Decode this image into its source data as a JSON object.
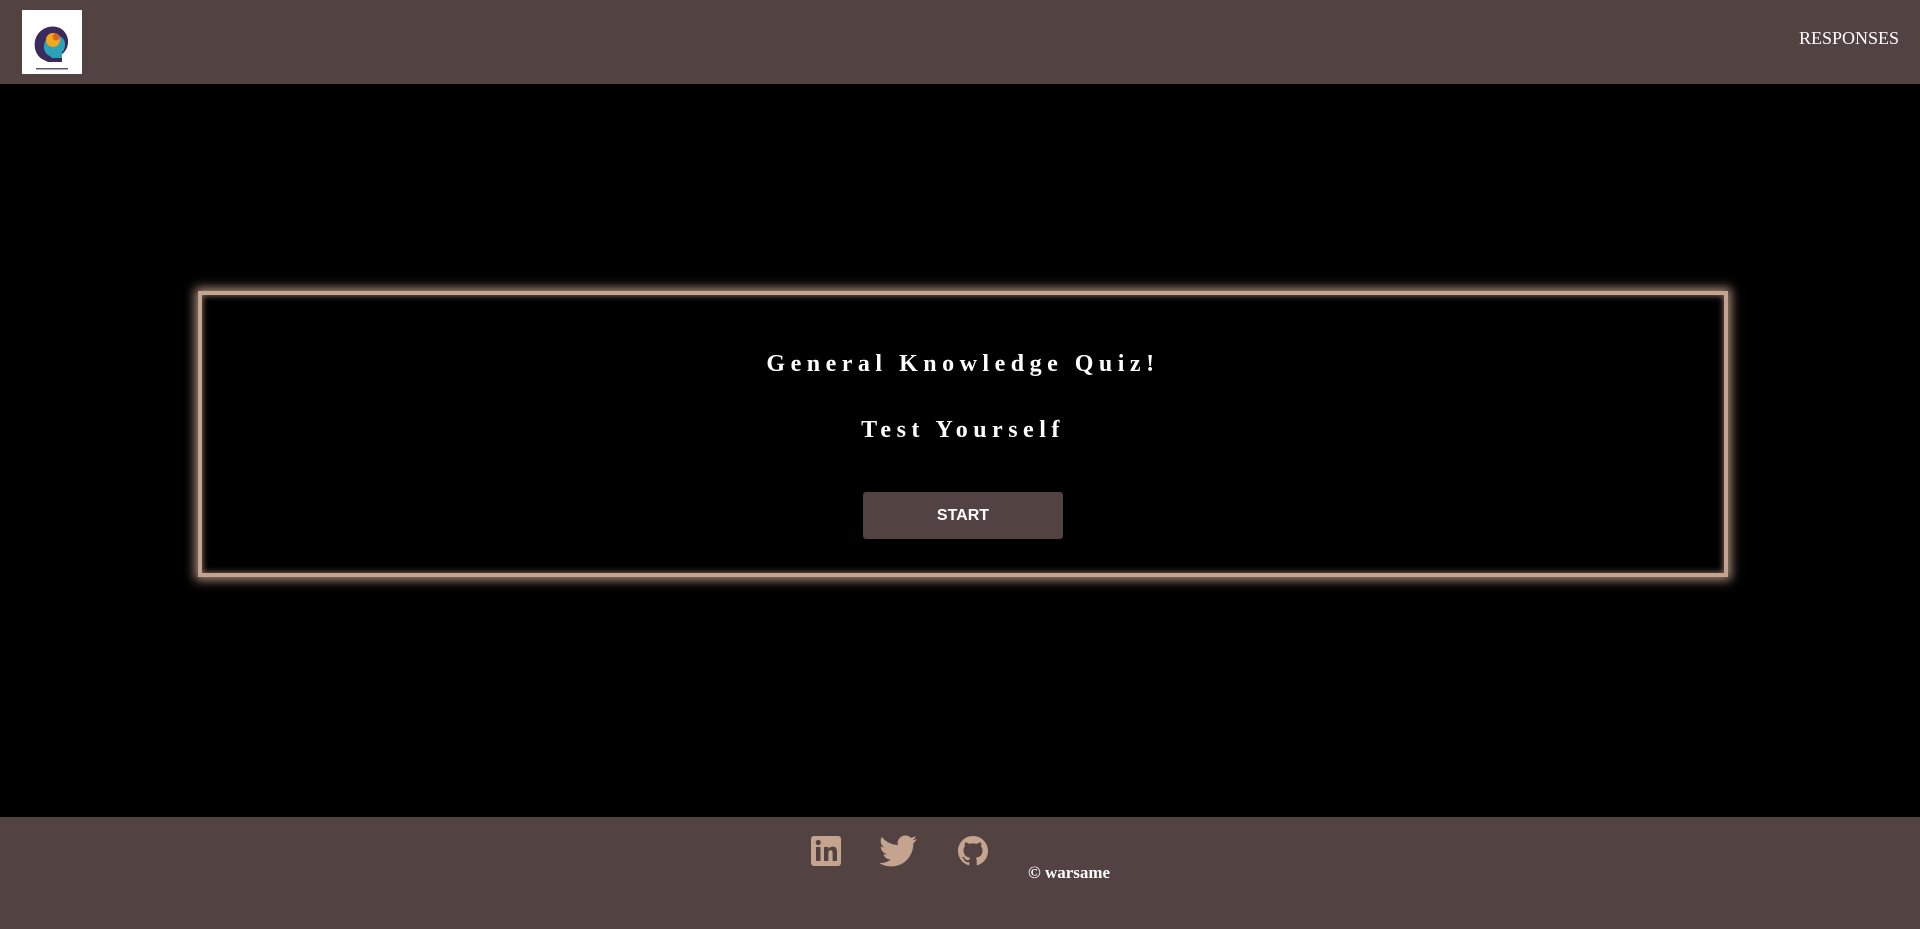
{
  "colors": {
    "nav_background": "#524241",
    "page_background": "#000000",
    "card_border": "#c4a48f",
    "button_background": "#524241",
    "icon_color": "#c4a48f",
    "text": "#ffffff"
  },
  "header": {
    "logo_icon": "brain-head-logo-icon",
    "nav_link": "RESPONSES"
  },
  "quiz": {
    "title": "General Knowledge Quiz!",
    "subtitle": "Test Yourself",
    "start_label": "START"
  },
  "footer": {
    "social_icons": [
      "linkedin-icon",
      "twitter-icon",
      "github-icon"
    ],
    "copyright": "© warsame"
  }
}
